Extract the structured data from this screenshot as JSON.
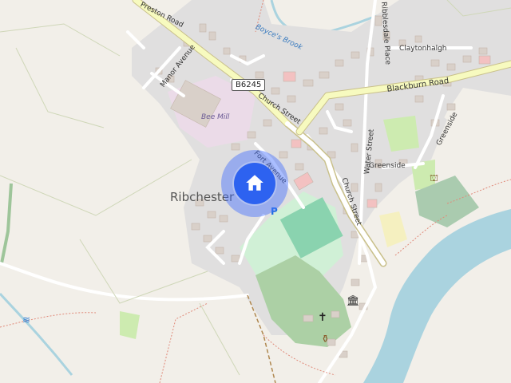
{
  "map": {
    "town_name": "Ribchester",
    "road_shield": "B6245",
    "mill_label": "Bee Mill",
    "parking_symbol": "P",
    "streets": {
      "preston_road": "Preston Road",
      "manor_avenue": "Manor Avenue",
      "church_street_1": "Church Street",
      "church_street_2": "Church Street",
      "fort_avenue": "Fort Avenue",
      "water_street": "Water Street",
      "greenside_1": "Greenside",
      "greenside_2": "Greenside",
      "ribblesdale_place": "Ribblesdale Place",
      "claytonhalgh": "Claytonhalgh",
      "blackburn_road": "Blackburn Road",
      "boyces_brook": "Boyce's Brook"
    },
    "marker": {
      "icon": "home-icon",
      "color": "#2d62f0"
    },
    "poi_icons": [
      "church-icon",
      "museum-icon",
      "amphora-icon",
      "monument-icon",
      "weir-icon"
    ]
  }
}
